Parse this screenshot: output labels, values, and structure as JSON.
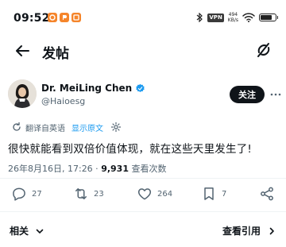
{
  "status_bar": {
    "time": "09:52",
    "vpn": "VPN",
    "speed_value": "494",
    "speed_unit": "KB/s",
    "battery_level": 0.85,
    "notification_icons": [
      "app-notification-icon-orange",
      "app-notification-icon-orange-2",
      "app-notification-icon-orange-3"
    ]
  },
  "nav": {
    "title": "发帖"
  },
  "tweet": {
    "author_name": "Dr. MeiLing Chen",
    "handle": "@Haioesg",
    "follow_label": "关注",
    "translated_from": "翻译自英语",
    "show_original": "显示原文",
    "text": "很快就能看到双倍价值体现，就在这些天里发生了!",
    "timestamp": "26年8月16日, 17:26 · ",
    "views_count": "9,931",
    "views_label": " 查看次数"
  },
  "actions": {
    "replies": "27",
    "retweets": "23",
    "likes": "264",
    "bookmarks": "7"
  },
  "bottom": {
    "related_label": "相关",
    "quotes_label": "查看引用"
  },
  "colors": {
    "accent": "#1d9bf0",
    "text": "#0f1419",
    "muted": "#536471",
    "notification": "#f5852b"
  }
}
